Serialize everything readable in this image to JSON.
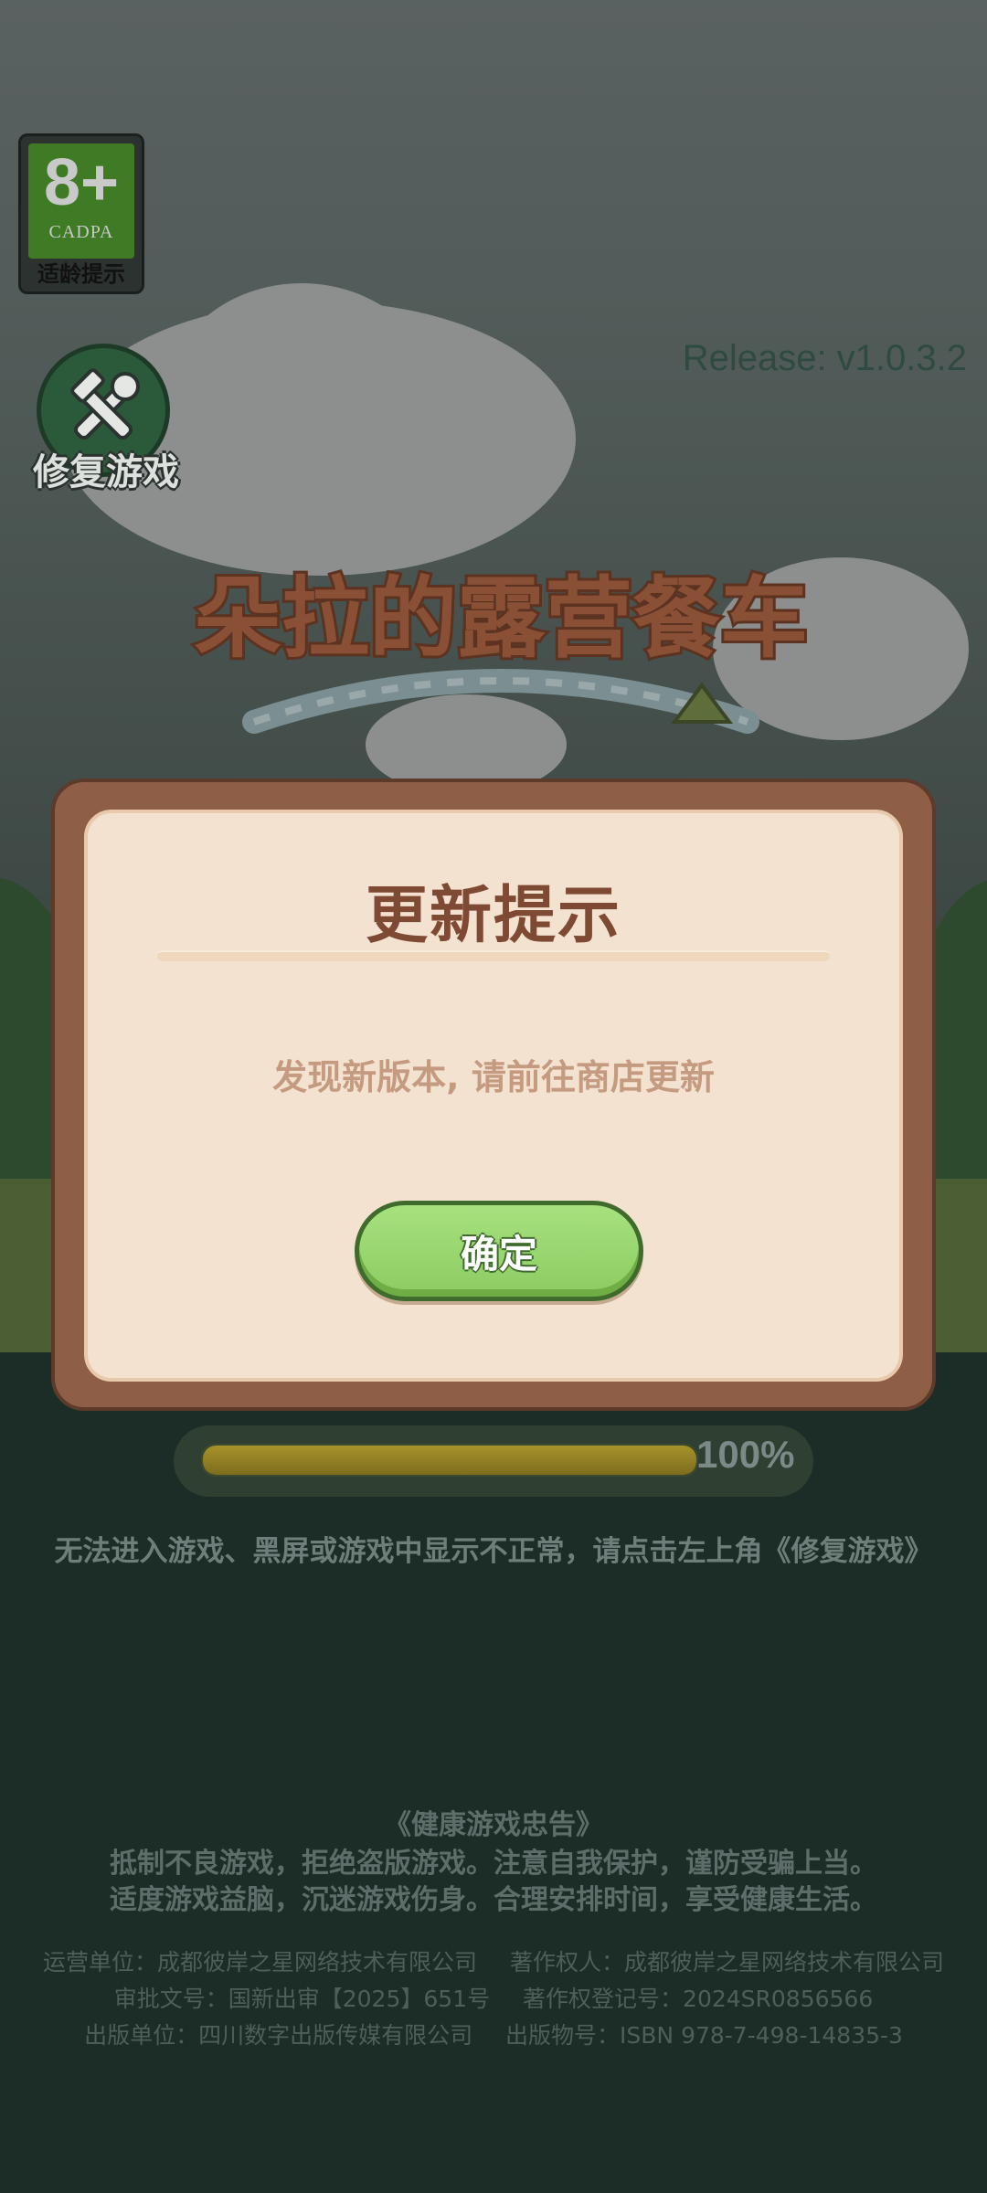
{
  "age_badge": {
    "rating": "8+",
    "org": "CADPA",
    "label": "适龄提示"
  },
  "repair": {
    "label": "修复游戏",
    "icon": "wrench-hammer-icon"
  },
  "release": "Release: v1.0.3.2",
  "logo_text": "朵拉的露营餐车",
  "dialog": {
    "title": "更新提示",
    "message": "发现新版本, 请前往商店更新",
    "confirm_label": "确定"
  },
  "progress": {
    "value": 1.0,
    "text": "100%"
  },
  "hint": "无法进入游戏、黑屏或游戏中显示不正常，请点击左上角《修复游戏》",
  "health_notice": {
    "title": "《健康游戏忠告》",
    "lines": [
      "抵制不良游戏，拒绝盗版游戏。注意自我保护，谨防受骗上当。",
      "适度游戏益脑，沉迷游戏伤身。合理安排时间，享受健康生活。"
    ]
  },
  "footer": {
    "operator": "运营单位：成都彼岸之星网络技术有限公司",
    "copyright_owner": "著作权人：成都彼岸之星网络技术有限公司",
    "approval_no": "审批文号：国新出审【2025】651号",
    "copyright_reg": "著作权登记号：2024SR0856566",
    "publisher": "出版单位：四川数字出版传媒有限公司",
    "isbn": "出版物号：ISBN 978-7-498-14835-3"
  }
}
